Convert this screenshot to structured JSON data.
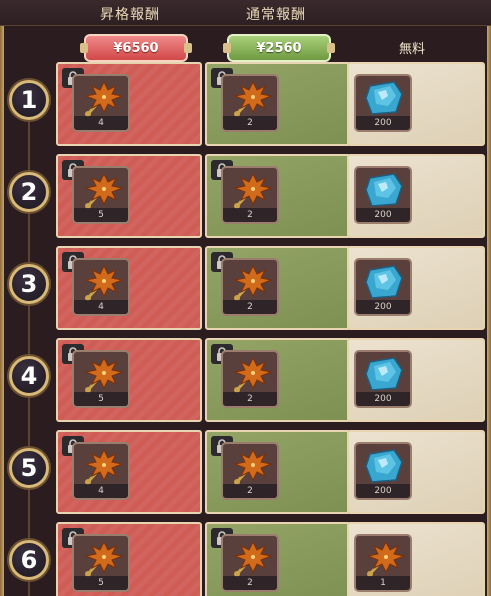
{
  "header": {
    "promotion_label": "昇格報酬",
    "normal_label": "通常報酬"
  },
  "tiers": {
    "promotion_price": "¥6560",
    "normal_price": "¥2560",
    "free_label": "無料",
    "colors": {
      "promotion": "#d24848",
      "normal": "#6f9a42",
      "free": "#ece2cf"
    }
  },
  "rows": [
    {
      "level": "1",
      "promotion": {
        "icon": "maple-key-icon",
        "qty": "4"
      },
      "normal": {
        "icon": "maple-key-icon",
        "qty": "2"
      },
      "free": {
        "icon": "blue-gem-icon",
        "qty": "200"
      }
    },
    {
      "level": "2",
      "promotion": {
        "icon": "maple-key-icon",
        "qty": "5"
      },
      "normal": {
        "icon": "maple-key-icon",
        "qty": "2"
      },
      "free": {
        "icon": "blue-gem-icon",
        "qty": "200"
      }
    },
    {
      "level": "3",
      "promotion": {
        "icon": "maple-key-icon",
        "qty": "4"
      },
      "normal": {
        "icon": "maple-key-icon",
        "qty": "2"
      },
      "free": {
        "icon": "blue-gem-icon",
        "qty": "200"
      }
    },
    {
      "level": "4",
      "promotion": {
        "icon": "maple-key-icon",
        "qty": "5"
      },
      "normal": {
        "icon": "maple-key-icon",
        "qty": "2"
      },
      "free": {
        "icon": "blue-gem-icon",
        "qty": "200"
      }
    },
    {
      "level": "5",
      "promotion": {
        "icon": "maple-key-icon",
        "qty": "4"
      },
      "normal": {
        "icon": "maple-key-icon",
        "qty": "2"
      },
      "free": {
        "icon": "blue-gem-icon",
        "qty": "200"
      }
    },
    {
      "level": "6",
      "promotion": {
        "icon": "maple-key-icon",
        "qty": "5"
      },
      "normal": {
        "icon": "maple-key-icon",
        "qty": "2"
      },
      "free": {
        "icon": "maple-key-icon",
        "qty": "1"
      }
    }
  ]
}
